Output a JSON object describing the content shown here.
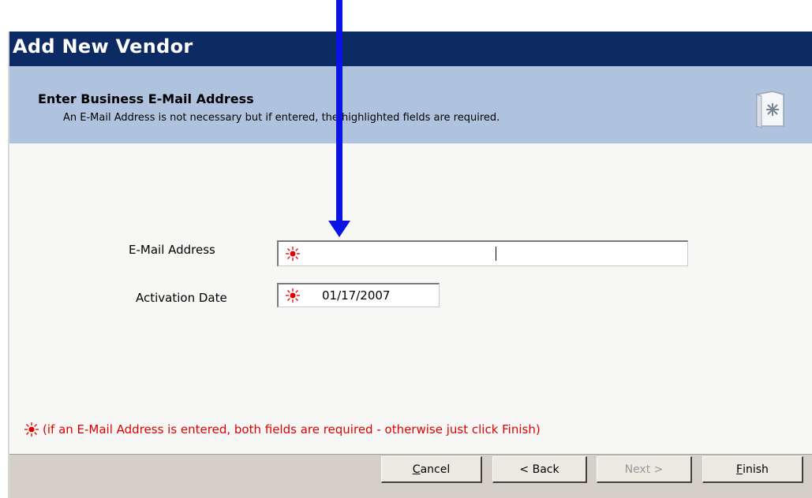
{
  "window": {
    "title": "Add New Vendor"
  },
  "header": {
    "title": "Enter Business E-Mail Address",
    "subtitle": "An E-Mail Address is not necessary but if entered, the highlighted fields are required."
  },
  "form": {
    "email_label": "E-Mail Address",
    "email_value": "",
    "activation_label": "Activation Date",
    "activation_value": "01/17/2007"
  },
  "note": "(if an E-Mail Address is entered, both fields are required - otherwise just click Finish)",
  "buttons": {
    "cancel_first": "C",
    "cancel_rest": "ancel",
    "back": "< Back",
    "next": "Next >",
    "finish_first": "F",
    "finish_rest": "inish"
  },
  "colors": {
    "titlebar": "#0c2a63",
    "header_bg": "#b0c3de",
    "required_marker": "#e00000",
    "annotation_arrow": "#0a14e6"
  },
  "icons": [
    "required-field-icon",
    "wizard-document-icon",
    "annotation-arrow"
  ]
}
